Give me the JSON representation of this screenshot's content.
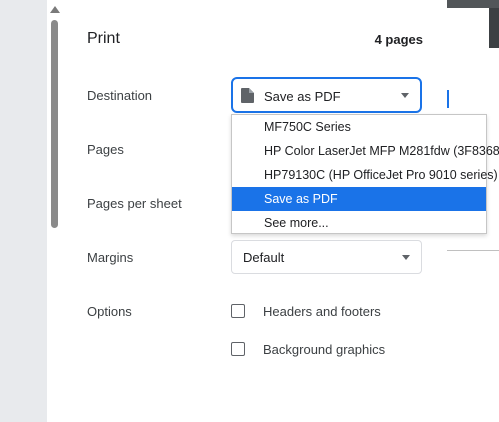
{
  "dialog": {
    "title": "Print",
    "page_count": "4 pages"
  },
  "labels": {
    "destination": "Destination",
    "pages": "Pages",
    "pages_per_sheet": "Pages per sheet",
    "margins": "Margins",
    "options": "Options"
  },
  "destination": {
    "selected": "Save as PDF",
    "icon": "document-icon",
    "options": [
      "MF750C Series",
      "HP Color LaserJet MFP M281fdw (3F8368)",
      "HP79130C (HP OfficeJet Pro 9010 series)",
      "Save as PDF",
      "See more..."
    ]
  },
  "margins": {
    "selected": "Default"
  },
  "options": {
    "headers_footers": {
      "label": "Headers and footers",
      "checked": false
    },
    "background_graphics": {
      "label": "Background graphics",
      "checked": false
    }
  },
  "colors": {
    "accent": "#1a73e8",
    "preview_bg": "#525659"
  }
}
